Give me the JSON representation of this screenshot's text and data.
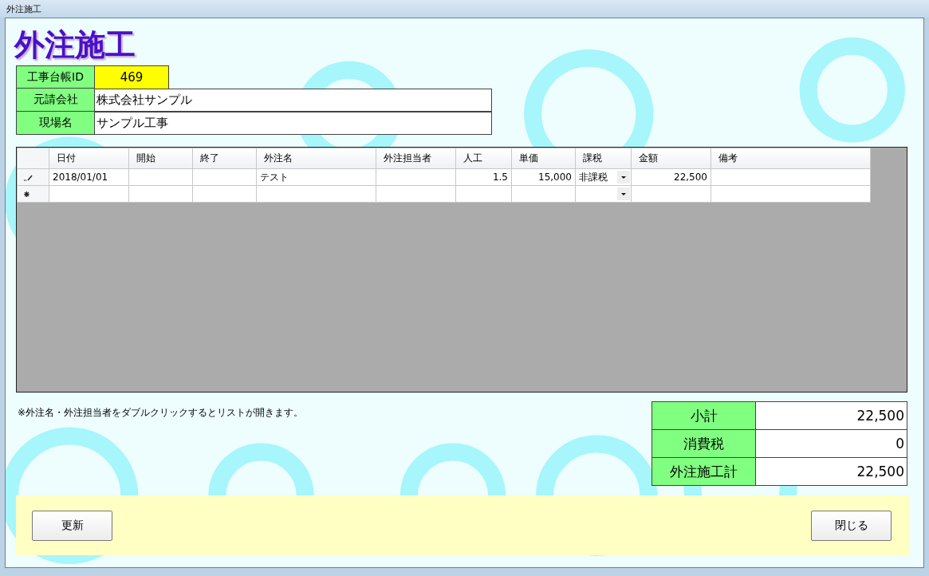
{
  "window": {
    "title": "外注施工"
  },
  "heading": "外注施工",
  "info": [
    {
      "label": "工事台帳ID",
      "value": "469",
      "kind": "id"
    },
    {
      "label": "元請会社",
      "value": "株式会社サンプル",
      "kind": "text"
    },
    {
      "label": "現場名",
      "value": "サンプル工事",
      "kind": "text"
    }
  ],
  "grid": {
    "columns": [
      {
        "label": "日付",
        "kind": "text"
      },
      {
        "label": "開始",
        "kind": "text"
      },
      {
        "label": "終了",
        "kind": "text"
      },
      {
        "label": "外注名",
        "kind": "text"
      },
      {
        "label": "外注担当者",
        "kind": "text"
      },
      {
        "label": "人工",
        "kind": "number"
      },
      {
        "label": "単価",
        "kind": "number"
      },
      {
        "label": "課税",
        "kind": "combo"
      },
      {
        "label": "金額",
        "kind": "number"
      },
      {
        "label": "備考",
        "kind": "text"
      }
    ],
    "rows": [
      {
        "kind": "editing",
        "cells": [
          "2018/01/01",
          "",
          "",
          "テスト",
          "",
          "1.5",
          "15,000",
          "非課税",
          "22,500",
          ""
        ]
      },
      {
        "kind": "new",
        "cells": [
          "",
          "",
          "",
          "",
          "",
          "",
          "",
          "",
          "",
          ""
        ]
      }
    ]
  },
  "note": "※外注名・外注担当者をダブルクリックするとリストが開きます。",
  "totals": [
    {
      "label": "小計",
      "value": "22,500"
    },
    {
      "label": "消費税",
      "value": "0"
    },
    {
      "label": "外注施工計",
      "value": "22,500"
    }
  ],
  "buttons": [
    {
      "label": "更新"
    },
    {
      "label": "閉じる"
    }
  ]
}
